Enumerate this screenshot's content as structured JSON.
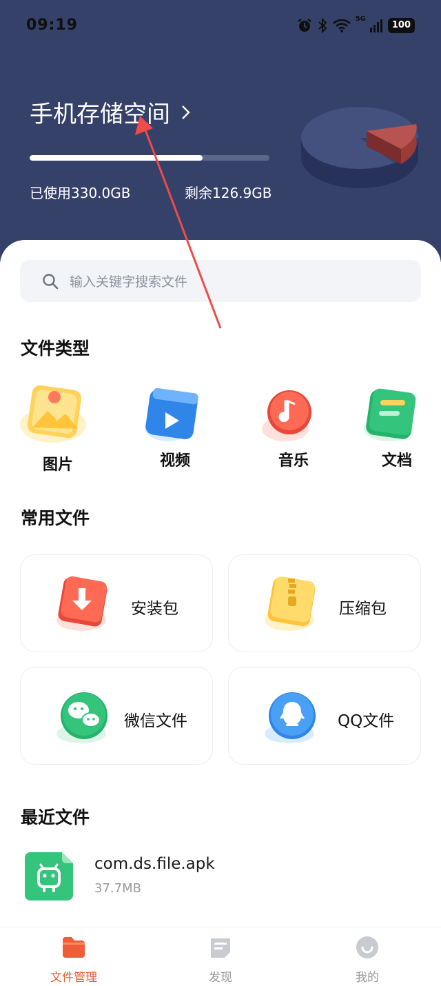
{
  "status_bar": {
    "time": "09:19",
    "network": "5G",
    "battery": "100"
  },
  "storage": {
    "title": "手机存储空间",
    "used": "已使用330.0GB",
    "free": "剩余126.9GB",
    "used_fraction": 0.72
  },
  "search": {
    "placeholder": "输入关键字搜索文件"
  },
  "file_types": {
    "title": "文件类型",
    "items": [
      {
        "label": "图片",
        "icon": "image-icon"
      },
      {
        "label": "视频",
        "icon": "video-icon"
      },
      {
        "label": "音乐",
        "icon": "music-icon"
      },
      {
        "label": "文档",
        "icon": "document-icon"
      }
    ]
  },
  "common_files": {
    "title": "常用文件",
    "items": [
      {
        "label": "安装包",
        "icon": "install-package-icon"
      },
      {
        "label": "压缩包",
        "icon": "zip-archive-icon"
      },
      {
        "label": "微信文件",
        "icon": "wechat-icon"
      },
      {
        "label": "QQ文件",
        "icon": "qq-icon"
      }
    ]
  },
  "recent_files": {
    "title": "最近文件",
    "items": [
      {
        "name": "com.ds.file.apk",
        "size": "37.7MB",
        "icon": "android-apk-icon"
      }
    ]
  },
  "tabbar": {
    "tabs": [
      {
        "label": "文件管理",
        "icon": "folder-icon",
        "active": true
      },
      {
        "label": "发现",
        "icon": "discover-icon",
        "active": false
      },
      {
        "label": "我的",
        "icon": "profile-icon",
        "active": false
      }
    ]
  },
  "colors": {
    "header_bg": "#36416a",
    "accent": "#f05b38",
    "annotation_arrow": "#ef4b4b"
  }
}
